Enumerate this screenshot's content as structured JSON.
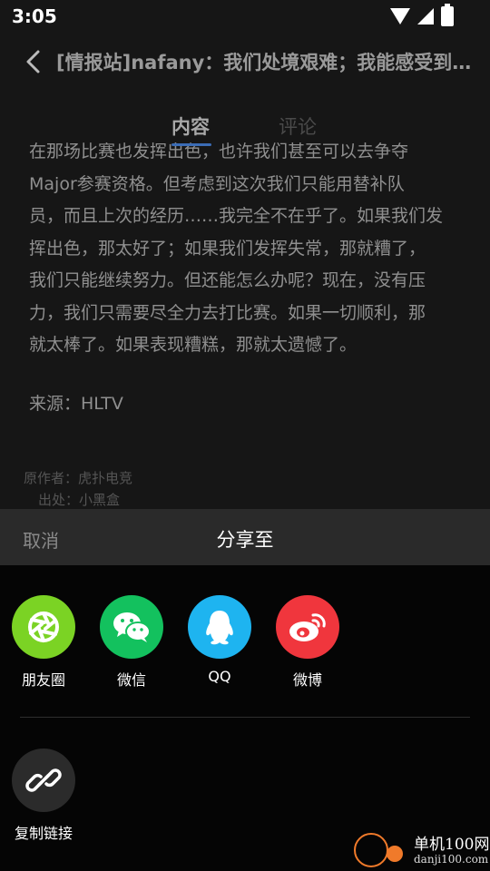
{
  "status_bar": {
    "time": "3:05"
  },
  "app_bar": {
    "title": "[情报站]nafany：我们处境艰难；我能感受到…"
  },
  "tabs": [
    {
      "label": "内容"
    },
    {
      "label": "评论"
    }
  ],
  "article": {
    "lines": [
      "在那场比赛也发挥出色，也许我们甚至可以去争夺",
      "Major参赛资格。但考虑到这次我们只能用替补队",
      "员，而且上次的经历……我完全不在乎了。如果我们发",
      "挥出色，那太好了；如果我们发挥失常，那就糟了，",
      "我们只能继续努力。但还能怎么办呢？现在，没有压",
      "力，我们只需要尽全力去打比赛。如果一切顺利，那",
      "就太棒了。如果表现糟糕，那就太遗憾了。"
    ],
    "source": "来源：HLTV",
    "original_author": "原作者：虎扑电竞",
    "origin": "出处：小黑盒"
  },
  "share_sheet": {
    "cancel_label": "取消",
    "title": "分享至",
    "targets": [
      {
        "label": "朋友圈",
        "icon": "moments-icon",
        "color": "#7bd324"
      },
      {
        "label": "微信",
        "icon": "wechat-icon",
        "color": "#13c15e"
      },
      {
        "label": "QQ",
        "icon": "qq-icon",
        "color": "#1eb4f0"
      },
      {
        "label": "微博",
        "icon": "weibo-icon",
        "color": "#f0363d"
      }
    ],
    "copy_link": {
      "label": "复制链接",
      "icon": "link-icon",
      "color": "#2b2b2b"
    }
  },
  "watermark": {
    "name": "单机100网",
    "url": "danji100.com"
  }
}
